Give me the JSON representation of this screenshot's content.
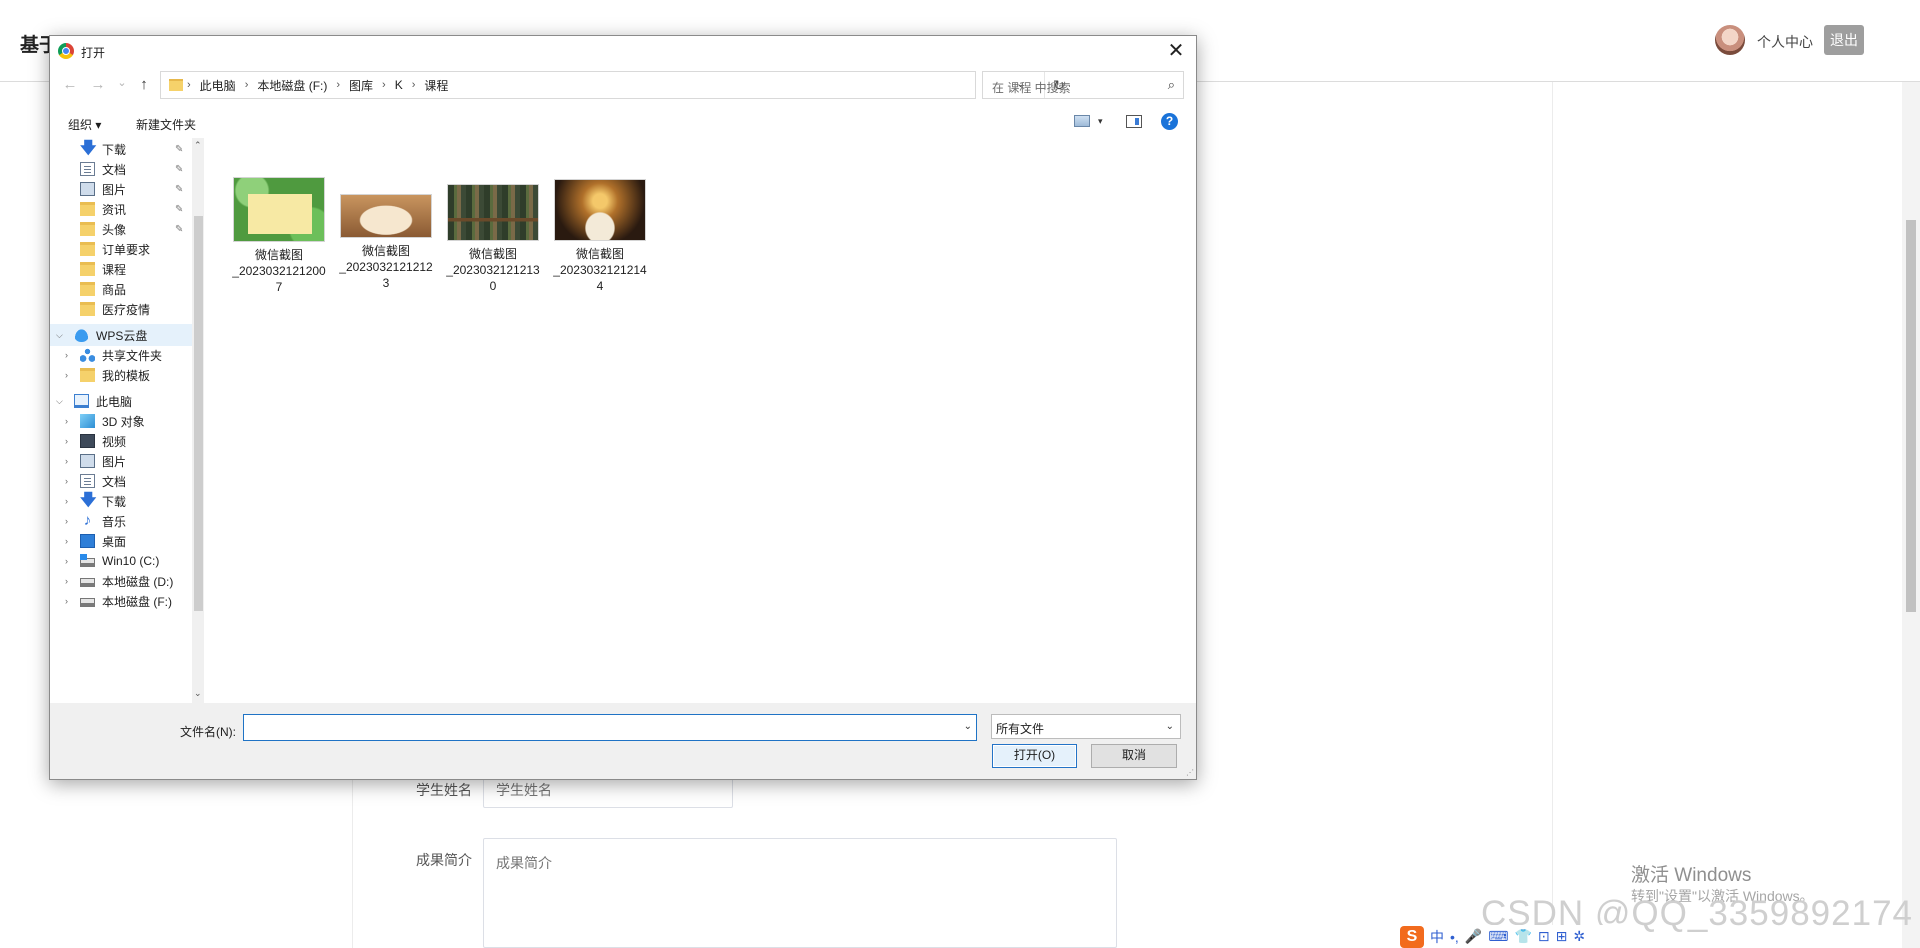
{
  "page": {
    "site_title": "基于",
    "user_center": "个人中心",
    "logout": "退出",
    "form": {
      "student_name_label": "学生姓名",
      "student_name_placeholder": "学生姓名",
      "summary_label": "成果简介",
      "summary_placeholder": "成果简介"
    },
    "activate_title": "激活 Windows",
    "activate_sub": "转到\"设置\"以激活 Windows。",
    "watermark": "CSDN @QQ_3359892174",
    "ime_items": [
      "中",
      "•,",
      "🎤",
      "⌨",
      "👕",
      "⊡",
      "⊞",
      "✲"
    ],
    "ime_logo": "S"
  },
  "dialog": {
    "title": "打开",
    "close": "✕",
    "nav": {
      "back": "←",
      "forward": "→",
      "recent": "⌄",
      "up": "↑"
    },
    "breadcrumbs": [
      "此电脑",
      "本地磁盘 (F:)",
      "图库",
      "K",
      "课程"
    ],
    "breadcrumb_sep": "›",
    "search_placeholder": "在 课程 中搜索",
    "toolbar": {
      "organize": "组织 ▾",
      "new_folder": "新建文件夹",
      "view_arrow": "▾",
      "help": "?"
    },
    "quick_access": [
      {
        "label": "下载",
        "icon": "download-icon",
        "pinned": true
      },
      {
        "label": "文档",
        "icon": "document-icon",
        "pinned": true
      },
      {
        "label": "图片",
        "icon": "picture-icon",
        "pinned": true
      },
      {
        "label": "资讯",
        "icon": "folder-icon",
        "pinned": true
      },
      {
        "label": "头像",
        "icon": "folder-icon",
        "pinned": true
      },
      {
        "label": "订单要求",
        "icon": "folder-icon",
        "pinned": false
      },
      {
        "label": "课程",
        "icon": "folder-icon",
        "pinned": false
      },
      {
        "label": "商品",
        "icon": "folder-icon",
        "pinned": false
      },
      {
        "label": "医疗疫情",
        "icon": "folder-icon",
        "pinned": false
      }
    ],
    "wps": {
      "label": "WPS云盘",
      "children": [
        "共享文件夹",
        "我的模板"
      ]
    },
    "this_pc": {
      "label": "此电脑",
      "children": [
        {
          "label": "3D 对象",
          "icon": "3d-objects-icon"
        },
        {
          "label": "视频",
          "icon": "video-icon"
        },
        {
          "label": "图片",
          "icon": "picture-icon"
        },
        {
          "label": "文档",
          "icon": "document-icon"
        },
        {
          "label": "下载",
          "icon": "download-icon"
        },
        {
          "label": "音乐",
          "icon": "music-icon"
        },
        {
          "label": "桌面",
          "icon": "desktop-icon"
        },
        {
          "label": "Win10 (C:)",
          "icon": "windows-drive-icon"
        },
        {
          "label": "本地磁盘 (D:)",
          "icon": "drive-icon"
        },
        {
          "label": "本地磁盘 (F:)",
          "icon": "drive-icon"
        }
      ]
    },
    "files": [
      {
        "name_line1": "微信截图",
        "name_line2": "_2023032121200",
        "name_line3": "7"
      },
      {
        "name_line1": "微信截图",
        "name_line2": "_2023032121212",
        "name_line3": "3"
      },
      {
        "name_line1": "微信截图",
        "name_line2": "_2023032121213",
        "name_line3": "0"
      },
      {
        "name_line1": "微信截图",
        "name_line2": "_2023032121214",
        "name_line3": "4"
      }
    ],
    "filename_label": "文件名(N):",
    "filename_value": "",
    "filetype": "所有文件",
    "open_button": "打开(O)",
    "cancel_button": "取消"
  }
}
